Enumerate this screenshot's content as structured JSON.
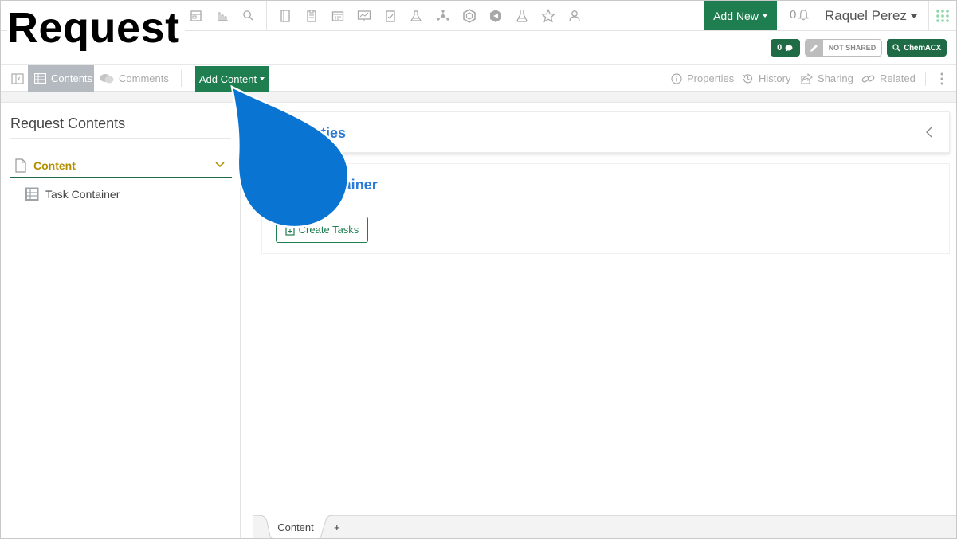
{
  "page": {
    "title": "Request"
  },
  "header": {
    "add_new_label": "Add New",
    "notification_count": "0",
    "user_name": "Raquel Perez",
    "icons": [
      "form-icon",
      "chart-icon",
      "search-icon",
      "notebook-icon",
      "clipboard-icon",
      "calendar-icon",
      "presentation-icon",
      "checklist-icon",
      "lab-flask-icon",
      "molecule-icon",
      "hexagon-icon",
      "shield-icon",
      "beaker-icon",
      "star-icon",
      "users-icon"
    ]
  },
  "badges": {
    "comment_count": "0",
    "share_label": "NOT SHARED",
    "chemacx_label": "ChemACX"
  },
  "toolbar": {
    "contents_label": "Contents",
    "comments_label": "Comments",
    "add_content_label": "Add Content",
    "properties_label": "Properties",
    "history_label": "History",
    "sharing_label": "Sharing",
    "related_label": "Related"
  },
  "sidebar": {
    "title": "Request Contents",
    "section_label": "Content",
    "items": [
      {
        "label": "Task Container"
      }
    ]
  },
  "main": {
    "properties_title": "Properties",
    "task_container_title": "Task Container",
    "create_tasks_label": "Create Tasks"
  },
  "bottom_tabs": {
    "tabs": [
      {
        "label": "Content"
      }
    ],
    "add_label": "+"
  },
  "colors": {
    "brand_green": "#1e7e4f",
    "dark_green": "#1e6b45",
    "link_blue": "#2d7bd6",
    "section_gold": "#b38f00",
    "cursor_blue": "#0a74d2"
  }
}
